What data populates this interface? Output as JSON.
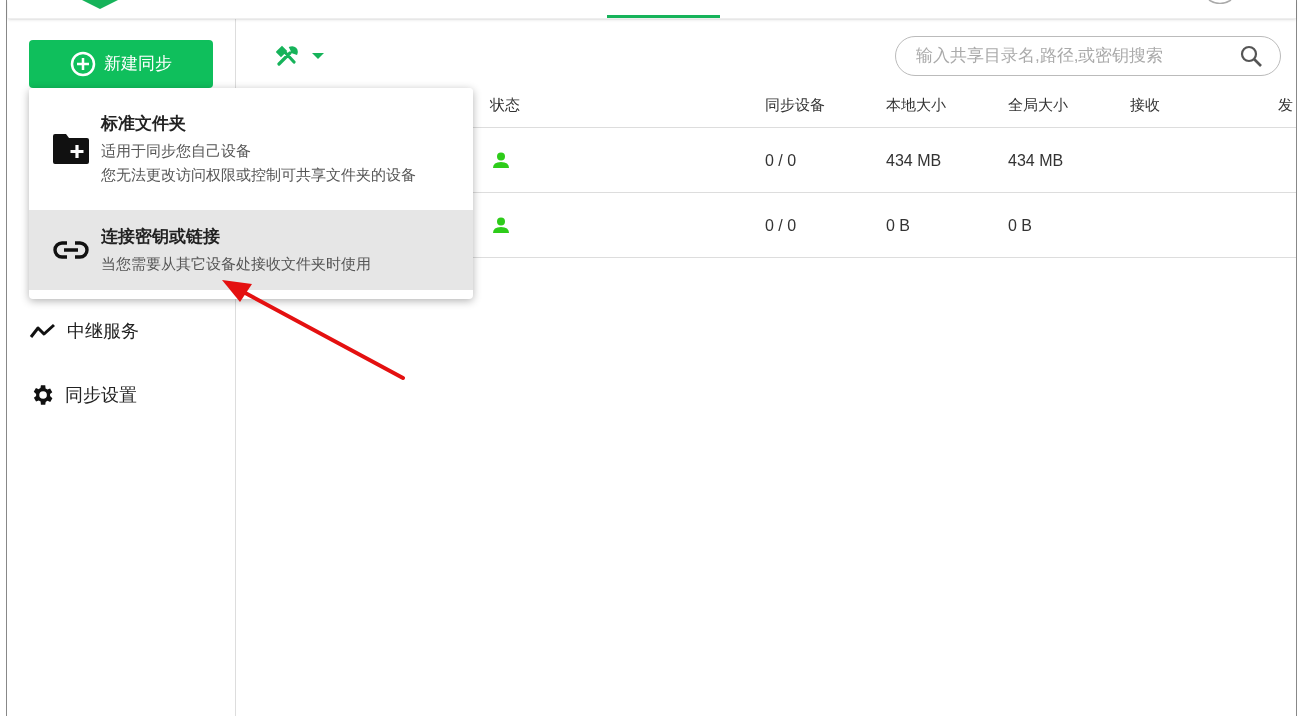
{
  "header": {
    "tabs": [
      {
        "selected": true
      }
    ]
  },
  "sidebar": {
    "new_button": "新建同步",
    "items": [
      {
        "kind": "relay",
        "label": "中继服务"
      },
      {
        "kind": "settings",
        "label": "同步设置"
      }
    ]
  },
  "toolbar": {
    "search": {
      "placeholder": "输入共享目录名,路径,或密钥搜索"
    }
  },
  "table": {
    "columns": [
      "状态",
      "同步设备",
      "本地大小",
      "全局大小",
      "接收",
      "发"
    ],
    "rows": [
      {
        "devices": "0 / 0",
        "local_size": "434 MB",
        "global_size": "434 MB"
      },
      {
        "devices": "0 / 0",
        "local_size": "0 B",
        "global_size": "0 B"
      }
    ]
  },
  "dropdown": {
    "items": [
      {
        "kind": "folder",
        "title": "标准文件夹",
        "lines": [
          "适用于同步您自己设备",
          "您无法更改访问权限或控制可共享文件夹的设备"
        ],
        "selected": false
      },
      {
        "kind": "link",
        "title": "连接密钥或链接",
        "lines": [
          "当您需要从其它设备处接收文件夹时使用"
        ],
        "selected": true
      }
    ]
  }
}
